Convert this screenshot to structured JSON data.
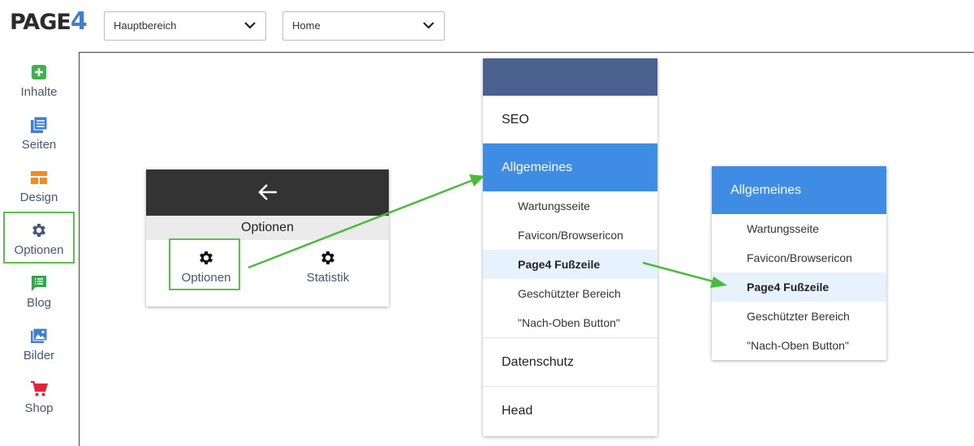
{
  "logo": {
    "part1": "PAGE",
    "part2": "4"
  },
  "selects": {
    "area": "Hauptbereich",
    "page": "Home"
  },
  "sidebar": {
    "items": [
      {
        "label": "Inhalte",
        "icon": "plus-square-icon",
        "color": "#3cb44b"
      },
      {
        "label": "Seiten",
        "icon": "pages-icon",
        "color": "#3f7fd1"
      },
      {
        "label": "Design",
        "icon": "design-icon",
        "color": "#f08c22"
      },
      {
        "label": "Optionen",
        "icon": "gear-icon",
        "color": "#44577a"
      },
      {
        "label": "Blog",
        "icon": "blog-icon",
        "color": "#2fa84f"
      },
      {
        "label": "Bilder",
        "icon": "images-icon",
        "color": "#3f7fd1"
      },
      {
        "label": "Shop",
        "icon": "cart-icon",
        "color": "#e8213a"
      }
    ]
  },
  "card": {
    "title": "Optionen",
    "buttons": [
      {
        "label": "Optionen",
        "icon": "gear-icon"
      },
      {
        "label": "Statistik",
        "icon": "gear-icon"
      }
    ]
  },
  "menu": {
    "main": [
      "SEO",
      "Allgemeines",
      "Datenschutz",
      "Head"
    ],
    "sub": [
      "Wartungsseite",
      "Favicon/Browsericon",
      "Page4 Fußzeile",
      "Geschützter Bereich",
      "\"Nach-Oben Button\""
    ]
  },
  "menu2": {
    "header": "Allgemeines",
    "sub": [
      "Wartungsseite",
      "Favicon/Browsericon",
      "Page4 Fußzeile",
      "Geschützter Bereich",
      "\"Nach-Oben Button\""
    ]
  },
  "colors": {
    "highlight": "#5cbf4a",
    "active_blue": "#3f8ce5",
    "menu_top": "#4a6190",
    "card_head": "#333333"
  }
}
